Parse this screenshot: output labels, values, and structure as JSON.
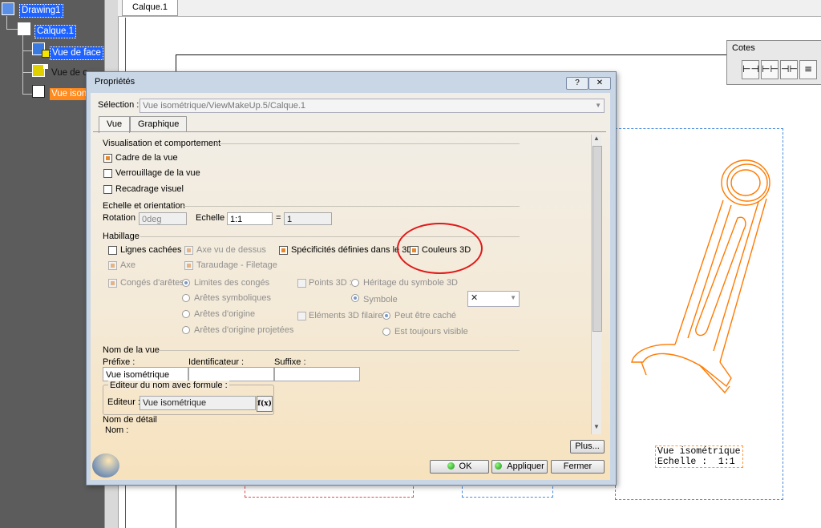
{
  "tree": {
    "root": "Drawing1",
    "sheet": "Calque.1",
    "views": [
      "Vue de face",
      "Vue de c",
      "Vue ison"
    ]
  },
  "document_tab": "Calque.1",
  "toolbar_cotes": {
    "title": "Cotes",
    "buttons": [
      "dimension-icon",
      "chained-dimension-icon",
      "cumulated-dimension-icon",
      "stacked-dimension-icon"
    ]
  },
  "drawing": {
    "caption_line1": "Vue isométrique",
    "caption_line2": "Echelle :  1:1",
    "part_color": "#ff7a00"
  },
  "dialog": {
    "title": "Propriétés",
    "help_btn": "?",
    "close_btn": "✕",
    "selection_label": "Sélection :",
    "selection_value": "Vue isométrique/ViewMakeUp.5/Calque.1",
    "tabs": [
      "Vue",
      "Graphique"
    ],
    "vis": {
      "heading": "Visualisation et comportement",
      "items": [
        {
          "label": "Cadre de la vue",
          "checked": true
        },
        {
          "label": "Verrouillage de la vue",
          "checked": false
        },
        {
          "label": "Recadrage visuel",
          "checked": false
        }
      ]
    },
    "scale": {
      "heading": "Echelle et orientation",
      "rotation_label": "Rotation :",
      "rotation_value": "0deg",
      "echelle_label": "Echelle :",
      "echelle_value": "1:1",
      "equals": "=",
      "result_value": "1"
    },
    "habillage": {
      "heading": "Habillage",
      "lignes_cachees": "Lignes cachées",
      "axe_vu_dessus": "Axe vu de dessus",
      "specificites": "Spécificités définies dans le 3D",
      "couleurs_3d": "Couleurs 3D",
      "axe": "Axe",
      "taraudage": "Taraudage - Filetage",
      "conges": "Congés d'arêtes",
      "limites_conges": "Limites des congés",
      "points_3d": "Points 3D :",
      "heritage": "Héritage du symbole 3D",
      "aretes_symb": "Arêtes symboliques",
      "symbole": "Symbole",
      "symbol_value": "✕",
      "aretes_origine": "Arêtes d'origine",
      "elements_filaires": "Eléments 3D filaires",
      "peut_etre_cache": "Peut être caché",
      "aretes_projetees": "Arêtes d'origine projetées",
      "toujours_visible": "Est toujours visible"
    },
    "nom": {
      "heading": "Nom de la vue",
      "prefixe_label": "Préfixe :",
      "identificateur_label": "Identificateur :",
      "suffixe_label": "Suffixe :",
      "prefixe_value": "Vue isométrique",
      "editor_group": "Editeur du nom avec formule :",
      "editeur_label": "Editeur :",
      "editeur_value": "Vue isométrique",
      "fx": "f(x)",
      "detail_heading": "Nom de détail",
      "nom_label": "Nom :"
    },
    "buttons": {
      "plus": "Plus...",
      "ok": "OK",
      "appliquer": "Appliquer",
      "fermer": "Fermer"
    }
  }
}
